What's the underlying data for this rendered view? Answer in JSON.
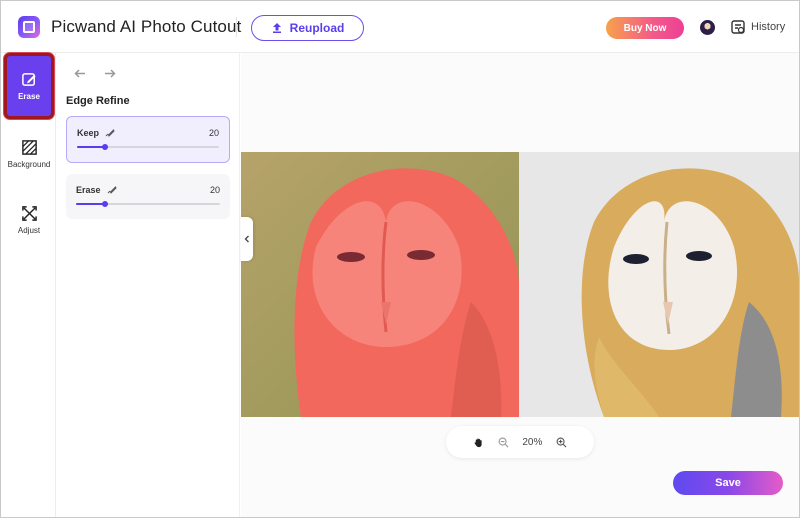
{
  "app": {
    "title": "Picwand AI Photo Cutout",
    "reupload_label": "Reupload",
    "buy_now_label": "Buy Now",
    "history_label": "History"
  },
  "sidebar": {
    "tools": [
      {
        "label": "Erase",
        "icon": "erase-icon",
        "active": true
      },
      {
        "label": "Background",
        "icon": "background-icon",
        "active": false
      },
      {
        "label": "Adjust",
        "icon": "adjust-icon",
        "active": false
      }
    ]
  },
  "panel": {
    "title": "Edge Refine",
    "keep": {
      "label": "Keep",
      "value": "20",
      "level": 0.2
    },
    "erase": {
      "label": "Erase",
      "value": "20",
      "level": 0.2
    }
  },
  "canvas": {
    "zoom": "20%",
    "save_label": "Save"
  },
  "colors": {
    "accent": "#6a40ee",
    "buy_now_gradient": [
      "#f7a24a",
      "#ee3f95"
    ],
    "save_gradient": [
      "#5e4af0",
      "#e45cc9"
    ],
    "keep_overlay": "#f26a5e"
  }
}
